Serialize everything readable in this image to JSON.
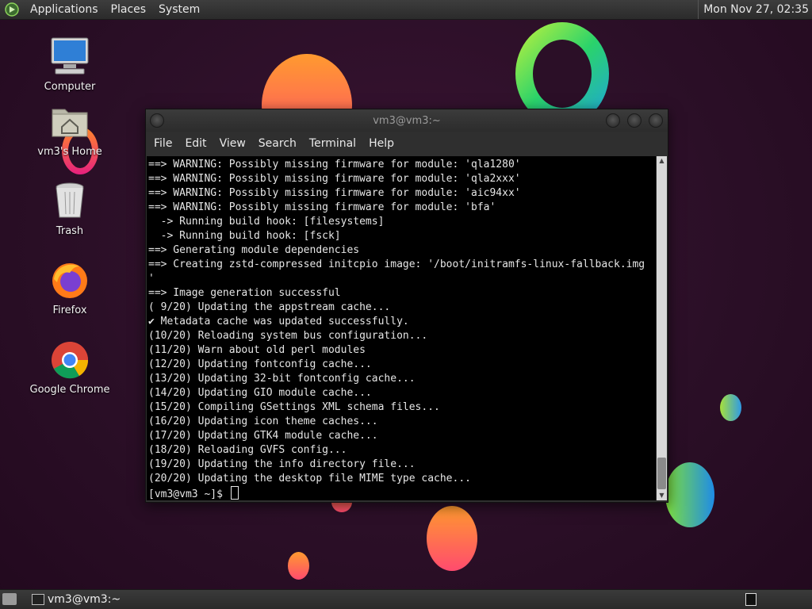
{
  "top_panel": {
    "menus": [
      "Applications",
      "Places",
      "System"
    ],
    "clock": "Mon Nov 27, 02:35"
  },
  "desktop_icons": [
    {
      "label": "Computer",
      "icon": "computer-icon"
    },
    {
      "label": "vm3's Home",
      "icon": "home-folder-icon"
    },
    {
      "label": "Trash",
      "icon": "trash-icon"
    },
    {
      "label": "Firefox",
      "icon": "firefox-icon"
    },
    {
      "label": "Google Chrome",
      "icon": "chrome-icon"
    }
  ],
  "window": {
    "title": "vm3@vm3:~",
    "menus": [
      "File",
      "Edit",
      "View",
      "Search",
      "Terminal",
      "Help"
    ],
    "terminal_lines": [
      "==> WARNING: Possibly missing firmware for module: 'qla1280'",
      "==> WARNING: Possibly missing firmware for module: 'qla2xxx'",
      "==> WARNING: Possibly missing firmware for module: 'aic94xx'",
      "==> WARNING: Possibly missing firmware for module: 'bfa'",
      "  -> Running build hook: [filesystems]",
      "  -> Running build hook: [fsck]",
      "==> Generating module dependencies",
      "==> Creating zstd-compressed initcpio image: '/boot/initramfs-linux-fallback.img",
      "'",
      "==> Image generation successful",
      "( 9/20) Updating the appstream cache...",
      "✔ Metadata cache was updated successfully.",
      "(10/20) Reloading system bus configuration...",
      "(11/20) Warn about old perl modules",
      "(12/20) Updating fontconfig cache...",
      "(13/20) Updating 32-bit fontconfig cache...",
      "(14/20) Updating GIO module cache...",
      "(15/20) Compiling GSettings XML schema files...",
      "(16/20) Updating icon theme caches...",
      "(17/20) Updating GTK4 module cache...",
      "(18/20) Reloading GVFS config...",
      "(19/20) Updating the info directory file...",
      "(20/20) Updating the desktop file MIME type cache..."
    ],
    "prompt": "[vm3@vm3 ~]$ "
  },
  "bottom_panel": {
    "task_label": "vm3@vm3:~"
  }
}
